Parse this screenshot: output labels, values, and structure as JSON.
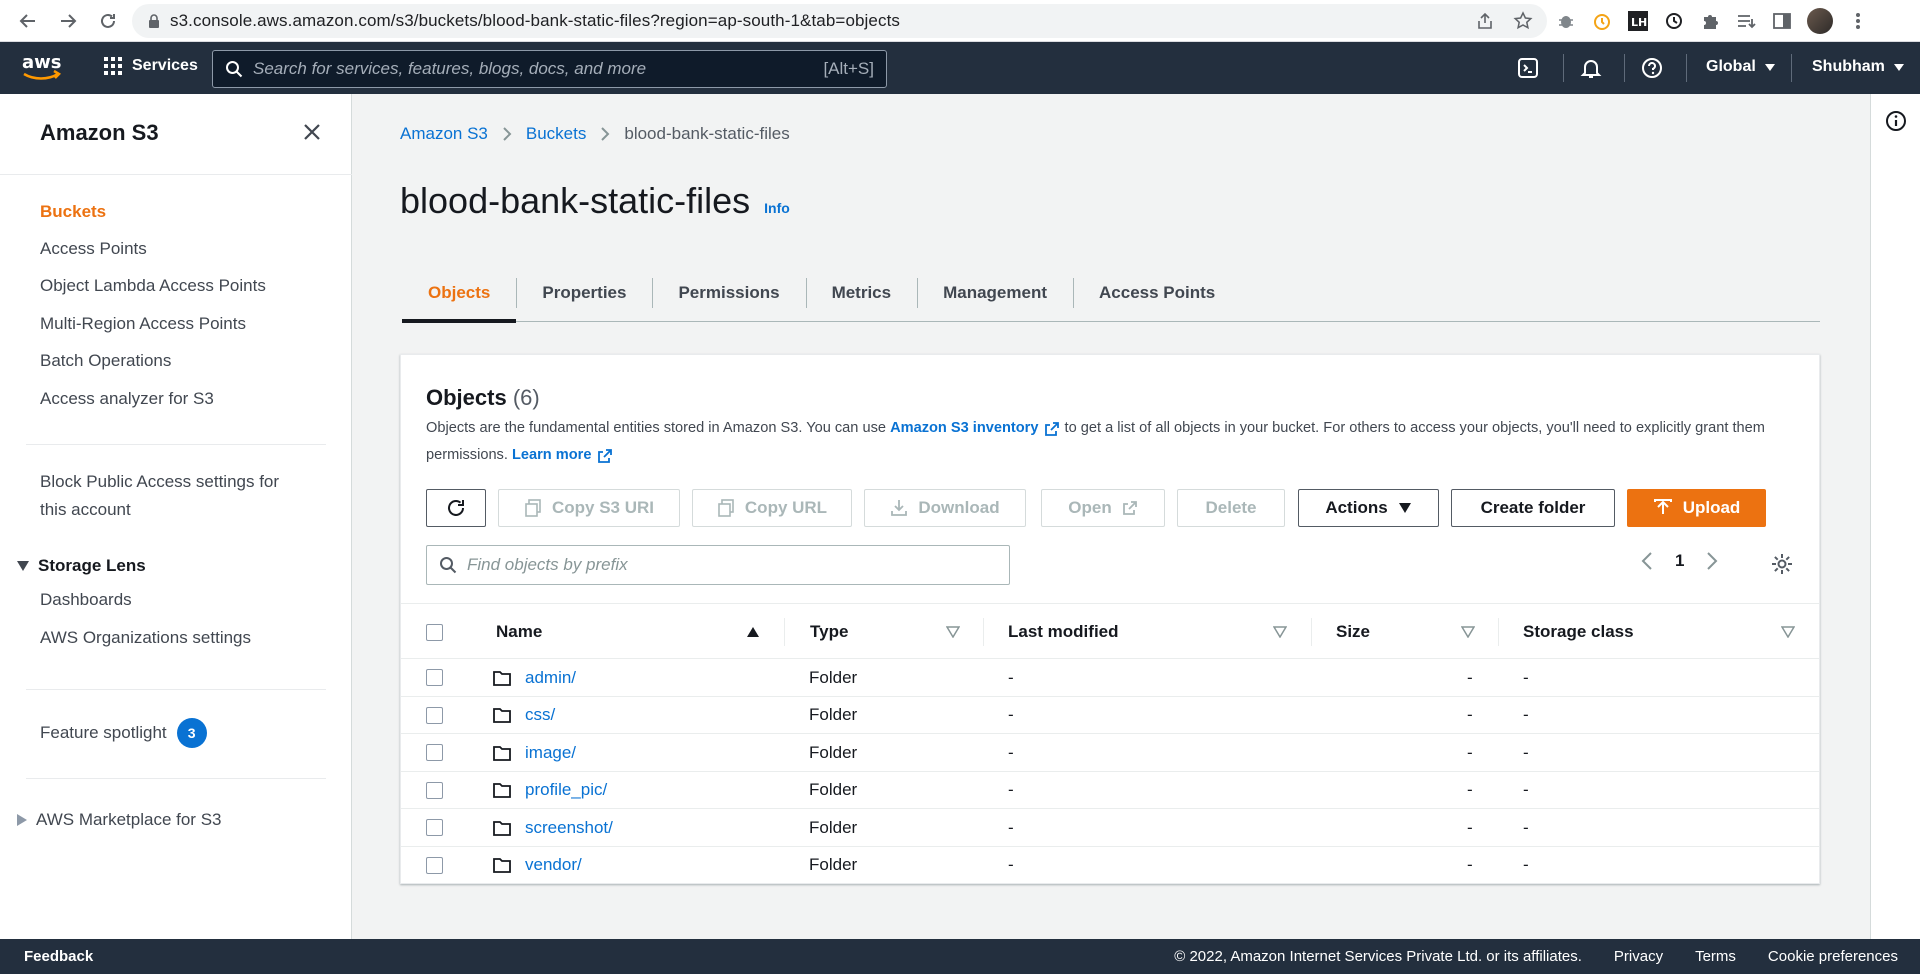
{
  "browser": {
    "url": "s3.console.aws.amazon.com/s3/buckets/blood-bank-static-files?region=ap-south-1&tab=objects"
  },
  "header": {
    "services_label": "Services",
    "search_placeholder": "Search for services, features, blogs, docs, and more",
    "search_shortcut": "[Alt+S]",
    "region_label": "Global",
    "user_label": "Shubham"
  },
  "sidebar": {
    "title": "Amazon S3",
    "items": [
      {
        "label": "Buckets",
        "active": true
      },
      {
        "label": "Access Points"
      },
      {
        "label": "Object Lambda Access Points"
      },
      {
        "label": "Multi-Region Access Points"
      },
      {
        "label": "Batch Operations"
      },
      {
        "label": "Access analyzer for S3"
      }
    ],
    "block_public_line1": "Block Public Access settings for",
    "block_public_line2": "this account",
    "storage_lens": {
      "title": "Storage Lens",
      "items": [
        "Dashboards",
        "AWS Organizations settings"
      ]
    },
    "feature_spotlight": {
      "label": "Feature spotlight",
      "badge": "3"
    },
    "marketplace": "AWS Marketplace for S3"
  },
  "breadcrumb": [
    "Amazon S3",
    "Buckets",
    "blood-bank-static-files"
  ],
  "page": {
    "title": "blood-bank-static-files",
    "info": "Info"
  },
  "tabs": [
    "Objects",
    "Properties",
    "Permissions",
    "Metrics",
    "Management",
    "Access Points"
  ],
  "objects_panel": {
    "title": "Objects",
    "count": "(6)",
    "desc_part1": "Objects are the fundamental entities stored in Amazon S3. You can use ",
    "desc_link1": "Amazon S3 inventory",
    "desc_part2": " to get a list of all objects in your bucket. For others to access your objects, you'll need to explicitly grant them permissions. ",
    "desc_link2": "Learn more",
    "buttons": {
      "copy_s3_uri": "Copy S3 URI",
      "copy_url": "Copy URL",
      "download": "Download",
      "open": "Open",
      "delete": "Delete",
      "actions": "Actions",
      "create_folder": "Create folder",
      "upload": "Upload"
    },
    "filter_placeholder": "Find objects by prefix",
    "page_number": "1",
    "columns": [
      "Name",
      "Type",
      "Last modified",
      "Size",
      "Storage class"
    ],
    "rows": [
      {
        "name": "admin/",
        "type": "Folder",
        "last_modified": "-",
        "size": "-",
        "storage_class": "-"
      },
      {
        "name": "css/",
        "type": "Folder",
        "last_modified": "-",
        "size": "-",
        "storage_class": "-"
      },
      {
        "name": "image/",
        "type": "Folder",
        "last_modified": "-",
        "size": "-",
        "storage_class": "-"
      },
      {
        "name": "profile_pic/",
        "type": "Folder",
        "last_modified": "-",
        "size": "-",
        "storage_class": "-"
      },
      {
        "name": "screenshot/",
        "type": "Folder",
        "last_modified": "-",
        "size": "-",
        "storage_class": "-"
      },
      {
        "name": "vendor/",
        "type": "Folder",
        "last_modified": "-",
        "size": "-",
        "storage_class": "-"
      }
    ]
  },
  "footer": {
    "feedback": "Feedback",
    "copyright": "© 2022, Amazon Internet Services Private Ltd. or its affiliates.",
    "links": [
      "Privacy",
      "Terms",
      "Cookie preferences"
    ]
  },
  "colors": {
    "aws_header": "#232f3e",
    "accent_orange": "#ec7211",
    "link_blue": "#0972d3"
  }
}
